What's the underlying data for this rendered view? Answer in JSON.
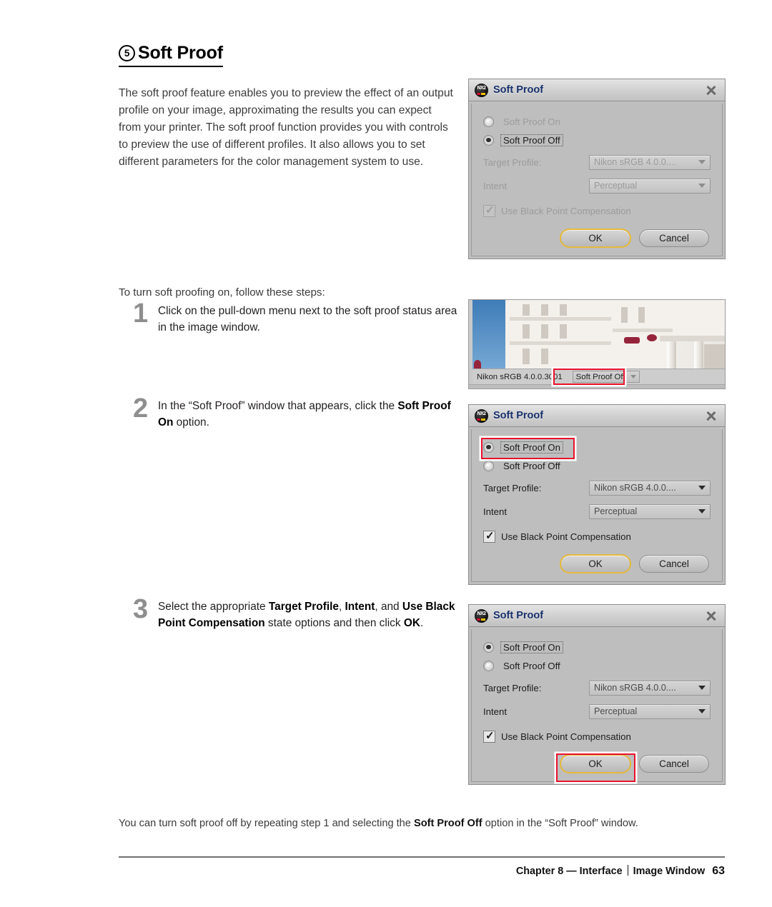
{
  "heading": {
    "number": "5",
    "title": "Soft Proof"
  },
  "intro_paragraph": "The soft proof feature enables you to preview the effect of an output profile on your image, approximating the results you can expect from your printer. The soft proof function provides you with controls to preview the use of different profiles. It also allows you to set different parameters for the color management system to use.",
  "lead_line": "To turn soft proofing on, follow these steps:",
  "steps": [
    {
      "number": "1",
      "text_html": "Click on the pull-down menu next to the soft proof status area in the image window."
    },
    {
      "number": "2",
      "text_html": "In the “Soft Proof” window that appears, click the <b>Soft Proof On</b> option."
    },
    {
      "number": "3",
      "text_html": "Select the appropriate <b>Target Profile</b>, <b>Intent</b>, and <b>Use Black Point Compensation</b> state options and then click <b>OK</b>."
    }
  ],
  "closing_paragraph_html": "You can turn soft proof off by repeating step 1 and selecting the <b>Soft Proof Off</b> option in the “Soft Proof” window.",
  "footer": {
    "chapter": "Chapter 8 — Interface",
    "section": "Image Window",
    "page": "63"
  },
  "dialog_common": {
    "title": "Soft Proof",
    "logo_text": "NX2",
    "close_icon": "close-icon",
    "radio_on_label": "Soft Proof On",
    "radio_off_label": "Soft Proof Off",
    "target_profile_label": "Target Profile:",
    "target_profile_value": "Nikon sRGB 4.0.0....",
    "intent_label": "Intent",
    "intent_value": "Perceptual",
    "black_point_label": "Use Black Point Compensation",
    "ok_label": "OK",
    "cancel_label": "Cancel"
  },
  "image_window": {
    "status_profile": "Nikon sRGB 4.0.0.3001",
    "status_proof": "Soft Proof Off"
  },
  "colors": {
    "annotation_red": "#e8112d",
    "default_button_focus": "#e6b93d",
    "dialog_title_blue": "#17306b",
    "dialog_face": "#bebebe",
    "step_number_gray": "#8e8e8e"
  }
}
